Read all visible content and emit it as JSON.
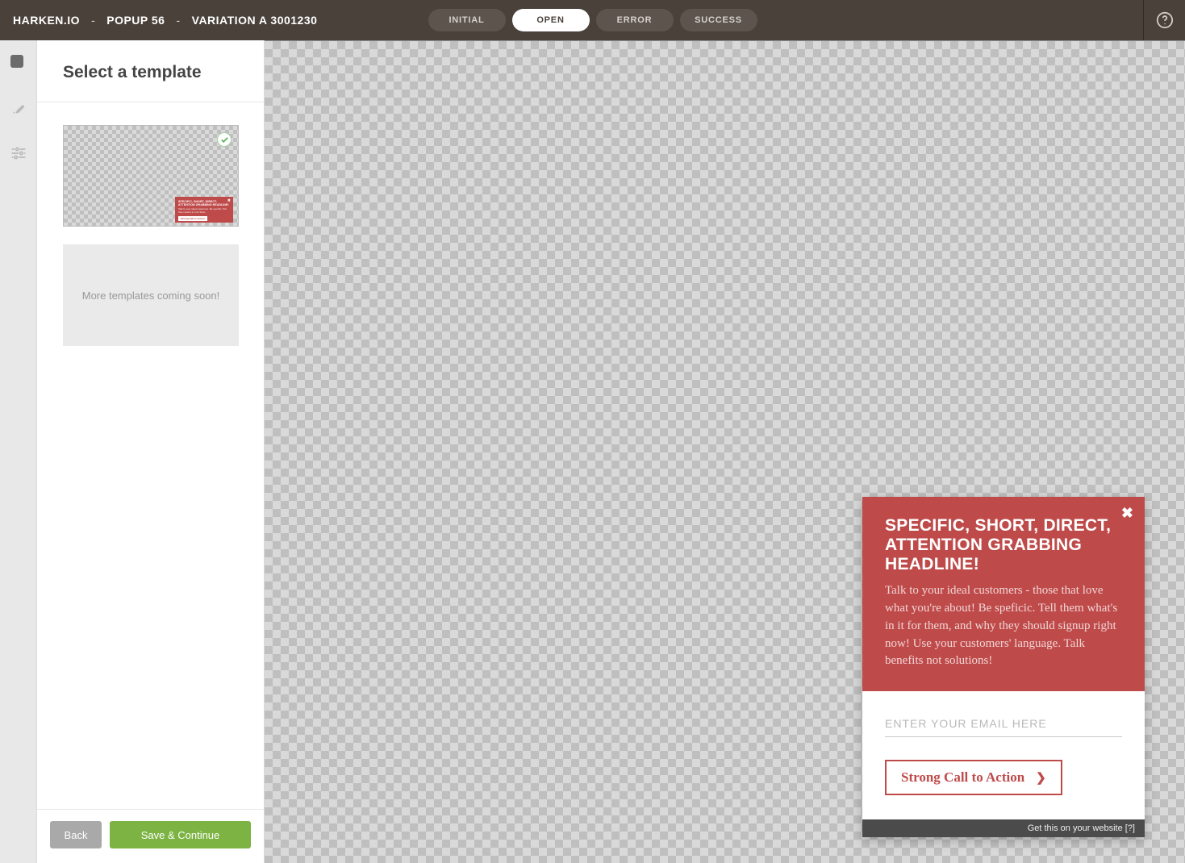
{
  "header": {
    "breadcrumb": {
      "site": "HARKEN.IO",
      "popup": "POPUP 56",
      "variation": "VARIATION A 3001230"
    },
    "states": {
      "initial": "INITIAL",
      "open": "OPEN",
      "error": "ERROR",
      "success": "SUCCESS",
      "active": "open"
    }
  },
  "sidebar": {
    "title": "Select a template",
    "coming_soon": "More templates coming soon!",
    "template1": {
      "headline": "SPECIFIC, SHORT, DIRECT, ATTENTION GRABBING HEADLINE!",
      "body_short": "Talk to your ideal customers. Be specific. Tell them what's in it for them.",
      "cta": "Strong Call to Action"
    },
    "footer": {
      "back": "Back",
      "save": "Save & Continue"
    }
  },
  "popup": {
    "headline": "SPECIFIC, SHORT, DIRECT, ATTENTION GRABBING HEADLINE!",
    "body": "Talk to your ideal customers - those that love what you're about! Be speficic. Tell them what's in it for them, and why they should signup right now! Use your customers' language. Talk benefits not solutions!",
    "email_placeholder": "ENTER YOUR EMAIL HERE",
    "cta": "Strong Call to Action",
    "footer": "Get this on your website [?]"
  },
  "colors": {
    "header_bg": "#4a413a",
    "accent_red": "#bf4a4a",
    "accent_green": "#7cb342"
  }
}
